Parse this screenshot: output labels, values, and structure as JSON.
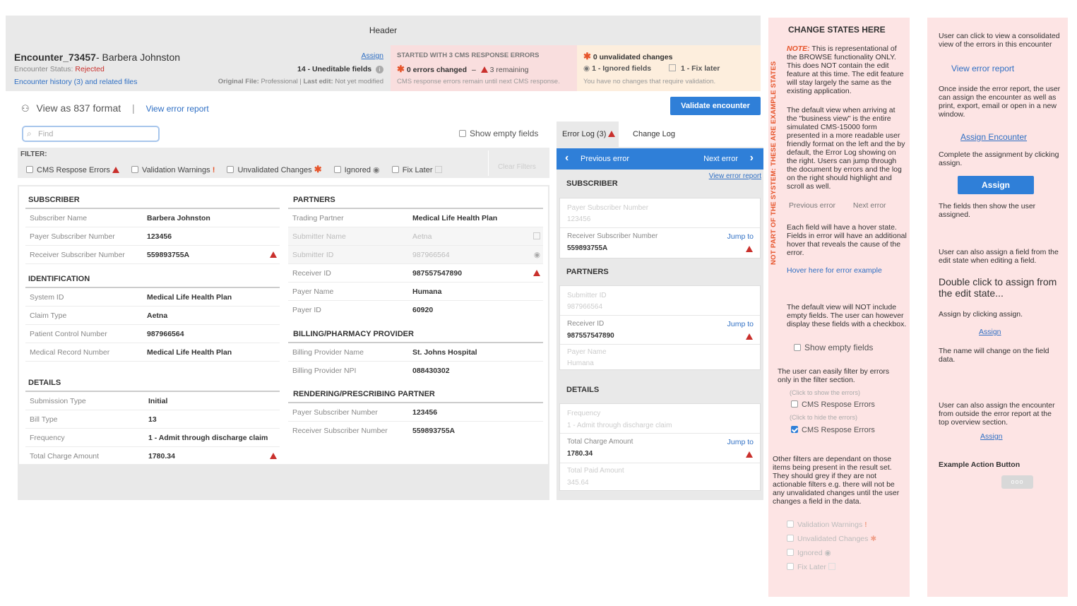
{
  "header": {
    "title": "Header"
  },
  "encounter": {
    "id": "Encounter_73457",
    "patient": "- Barbera Johnston",
    "status_label": "Encounter Status:",
    "status_value": "Rejected",
    "history_link": "Encounter history (3) and related files",
    "assign_link": "Assign",
    "uneditable": "14 - Uneditable fields",
    "original_file_label": "Original File:",
    "original_file_value": "Professional",
    "last_edit_label": "Last edit:",
    "last_edit_value": "Not yet modified"
  },
  "cms_box": {
    "title": "STARTED WITH 3 CMS RESPONSE ERRORS",
    "errors_changed": "0 errors changed",
    "dash": "–",
    "remaining": "3 remaining",
    "note": "CMS response errors remain until next CMS response."
  },
  "unvalidated_box": {
    "title": "0 unvalidated changes",
    "ignored": "1 - Ignored fields",
    "fix_later": "1 - Fix later",
    "note": "You have no changes that require validation."
  },
  "toolbar": {
    "view_837": "View as 837 format",
    "separator": "|",
    "view_error_report": "View error report",
    "validate_button": "Validate encounter",
    "find_placeholder": "Find",
    "show_empty": "Show empty fields"
  },
  "filter": {
    "label": "FILTER:",
    "items": [
      "CMS Respose Errors",
      "Validation Warnings",
      "Unvalidated Changes",
      "Ignored",
      "Fix Later"
    ],
    "clear": "Clear Filters"
  },
  "subscriber": {
    "title": "SUBSCRIBER",
    "rows": [
      {
        "label": "Subscriber Name",
        "value": "Barbera Johnston"
      },
      {
        "label": "Payer Subscriber Number",
        "value": "123456"
      },
      {
        "label": "Receiver Subscriber Number",
        "value": "559893755A"
      }
    ]
  },
  "identification": {
    "title": "IDENTIFICATION",
    "rows": [
      {
        "label": "System ID",
        "value": "Medical Life Health Plan"
      },
      {
        "label": "Claim Type",
        "value": "Aetna"
      },
      {
        "label": "Patient Control Number",
        "value": "987966564"
      },
      {
        "label": "Medical Record Number",
        "value": "Medical Life Health Plan"
      }
    ]
  },
  "details": {
    "title": "DETAILS",
    "rows": [
      {
        "label": "Submission Type",
        "value": "Initial"
      },
      {
        "label": "Bill Type",
        "value": "13"
      },
      {
        "label": "Frequency",
        "value": "1 - Admit through discharge claim"
      },
      {
        "label": "Total Charge Amount",
        "value": "1780.34"
      }
    ]
  },
  "partners": {
    "title": "PARTNERS",
    "rows": [
      {
        "label": "Trading Partner",
        "value": "Medical Life Health Plan"
      },
      {
        "label": "Submitter Name",
        "value": "Aetna"
      },
      {
        "label": "Submitter ID",
        "value": "987966564"
      },
      {
        "label": "Receiver ID",
        "value": "987557547890"
      },
      {
        "label": "Payer Name",
        "value": "Humana"
      },
      {
        "label": "Payer ID",
        "value": "60920"
      }
    ]
  },
  "billing": {
    "title": "BILLING/PHARMACY PROVIDER",
    "rows": [
      {
        "label": "Billing Provider Name",
        "value": "St. Johns Hospital"
      },
      {
        "label": "Billing Provider NPI",
        "value": "088430302"
      }
    ]
  },
  "rendering": {
    "title": "RENDERING/PRESCRIBING PARTNER",
    "rows": [
      {
        "label": "Payer Subscriber Number",
        "value": "123456"
      },
      {
        "label": "Receiver Subscriber Number",
        "value": "559893755A"
      }
    ]
  },
  "error_log": {
    "tab_error": "Error Log (3)",
    "tab_change": "Change Log",
    "prev": "Previous error",
    "next": "Next error",
    "view_report": "View error report",
    "jump": "Jump to",
    "subscriber_title": "SUBSCRIBER",
    "sub_f1_label": "Payer Subscriber Number",
    "sub_f1_value": "123456",
    "sub_f2_label": "Receiver Subscriber Number",
    "sub_f2_value": "559893755A",
    "partners_title": "PARTNERS",
    "par_f1_label": "Submitter ID",
    "par_f1_value": "987966564",
    "par_f2_label": "Receiver ID",
    "par_f2_value": "987557547890",
    "par_f3_label": "Payer Name",
    "par_f3_value": "Humana",
    "details_title": "DETAILS",
    "det_f1_label": "Frequency",
    "det_f1_value": "1 - Admit through discharge claim",
    "det_f2_label": "Total Charge Amount",
    "det_f2_value": "1780.34",
    "det_f3_label": "Total Paid Amount",
    "det_f3_value": "345.64"
  },
  "notes1": {
    "vertical": "NOT PART OF THE SYSTEM: THESE ARE EXAMPLE STATES",
    "title": "CHANGE STATES HERE",
    "note_label": "NOTE:",
    "note": "This is representational of the BROWSE functionality ONLY. This does NOT contain the edit feature at this time. The edit feature will stay largely the same as the existing application.",
    "p2": "The default view when arriving at the \"business view\" is the entire simulated CMS-15000 form presented in a more readable user friendly format on the left and the by default, the Error Log showing on the right. Users can jump through the document by errors and the log on the right should highlight and scroll as well.",
    "prev": "Previous error",
    "next": "Next error",
    "p3": "Each field will have a hover state. Fields in error will have an additional hover that reveals the cause of the error.",
    "hover_link": "Hover here for error example",
    "p4": "The default view will NOT include empty fields. The user can however display these fields with a checkbox.",
    "show_empty": "Show empty fields",
    "p5": "The user can easily filter by errors only in the filter section.",
    "click_show": "(Click to show the errors)",
    "cms1": "CMS Respose Errors",
    "click_hide": "(Click to hide the errors)",
    "cms2": "CMS Respose Errors",
    "p6": "Other filters are dependant on those items being present in the result set. They should grey if they are not actionable filters e.g. there will not be any unvalidated changes until the user changes a field in the data.",
    "g1": "Validation Warnings",
    "g2": "Unvalidated Changes",
    "g3": "Ignored",
    "g4": "Fix Later"
  },
  "notes2": {
    "p1": "User can click to view a consolidated view of the errors in this encounter",
    "view_report": "View error report",
    "p2": "Once inside the error report, the user can assign the encounter as well as print, export, email or open in a new window.",
    "assign_link": "Assign Encounter",
    "p3": "Complete the assignment by clicking assign.",
    "assign_button": "Assign",
    "p4": "The fields then show the user assigned.",
    "p5": "User can also assign a field from the edit state when editing a field.",
    "big": "Double click to assign from the edit state...",
    "p6": "Assign by clicking assign.",
    "assign1": "Assign",
    "p7": "The name will change on the field data.",
    "p8": "User can also assign the encounter from outside the error report at the top overview section.",
    "assign2": "Assign",
    "example_title": "Example Action Button",
    "example_btn": "ooo"
  },
  "colors": {
    "accent": "#2f7fd8",
    "error": "#c9302c",
    "note_bg": "#fde4e4"
  }
}
